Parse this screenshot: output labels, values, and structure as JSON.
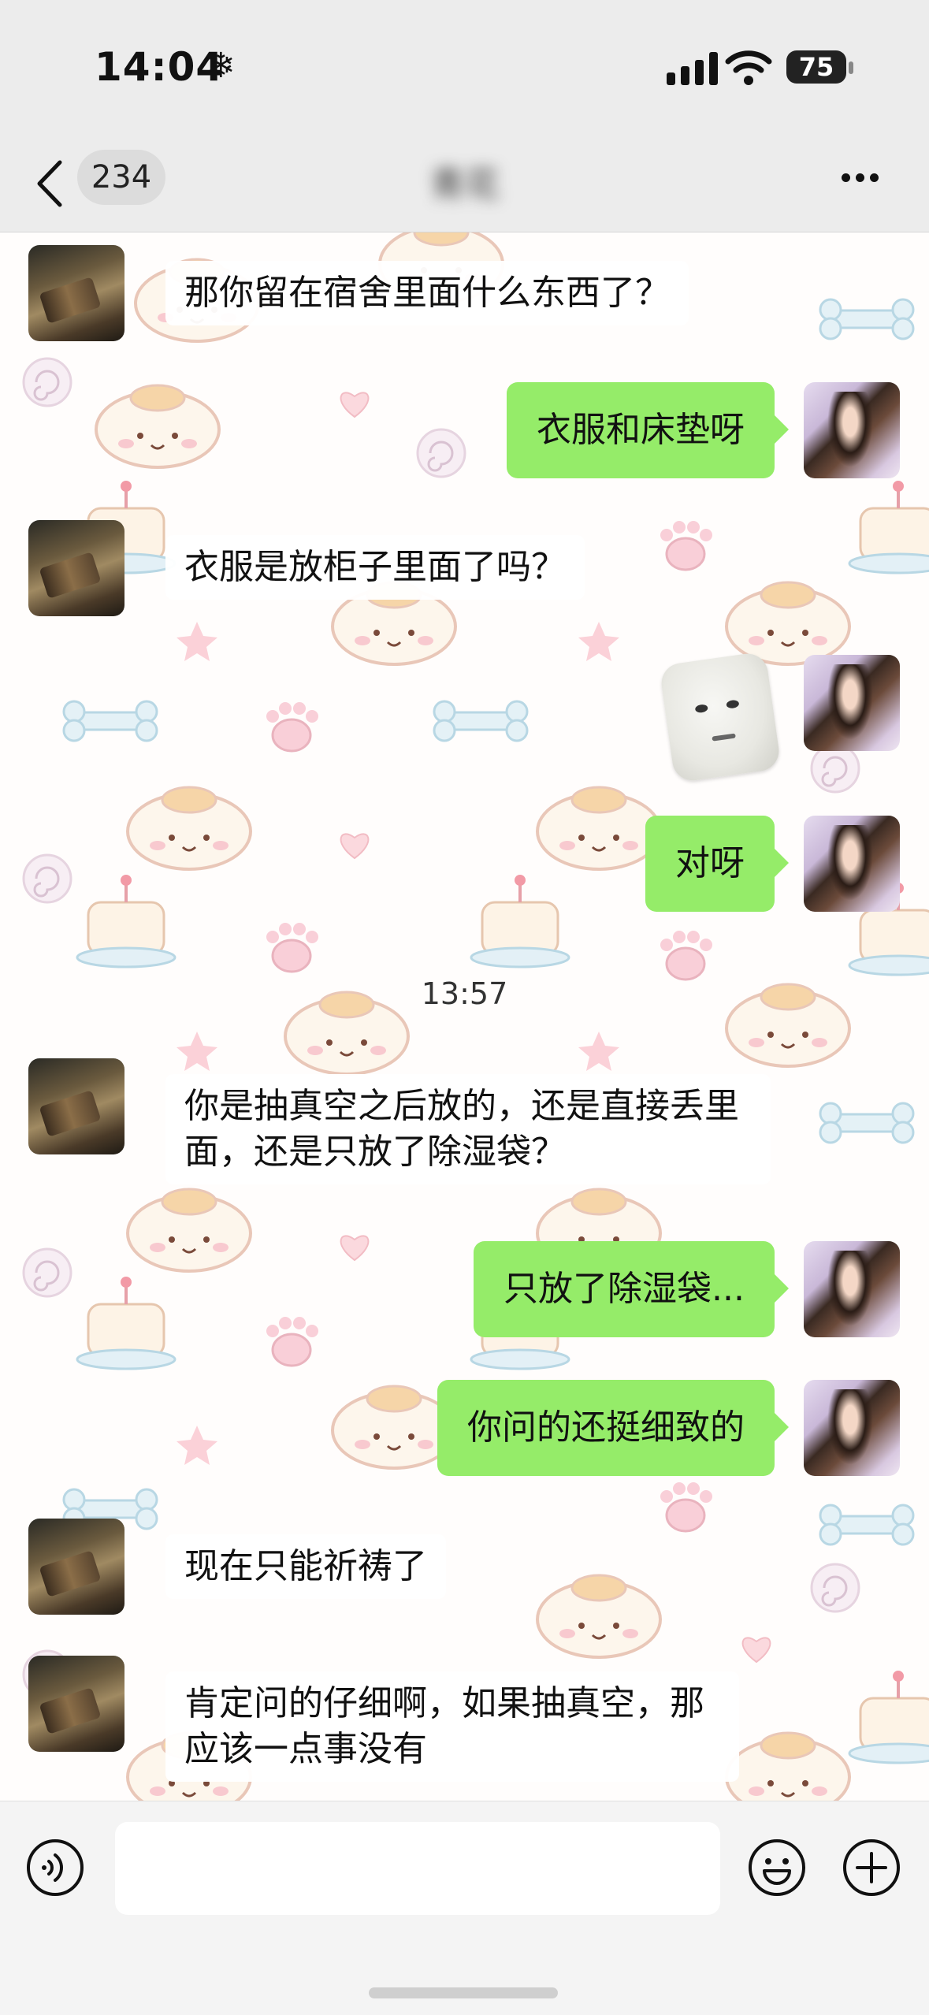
{
  "status_bar": {
    "time": "14:04",
    "weather_glyph": "❄",
    "battery_level": "75"
  },
  "nav_bar": {
    "unread_count": "234",
    "contact_name": "青花",
    "back_icon": "chevron-left-icon",
    "more_icon": "ellipsis-icon"
  },
  "messages": [
    {
      "side": "them",
      "text": "那你留在宿舍里面什么东西了？"
    },
    {
      "side": "me",
      "text": "衣服和床垫呀"
    },
    {
      "side": "them",
      "text": "衣服是放柜子里面了吗？"
    },
    {
      "side": "me",
      "type": "sticker",
      "sticker": "tofu-face-sticker"
    },
    {
      "side": "me",
      "text": "对呀"
    },
    {
      "side": "them",
      "text": "你是抽真空之后放的，还是直接丢里面，还是只放了除湿袋？"
    },
    {
      "side": "me",
      "text": "只放了除湿袋..."
    },
    {
      "side": "me",
      "text": "你问的还挺细致的"
    },
    {
      "side": "them",
      "text": "现在只能祈祷了"
    },
    {
      "side": "them",
      "text": "肯定问的仔细啊，如果抽真空，那应该一点事没有"
    }
  ],
  "timestamp_divider": "13:57",
  "input_bar": {
    "voice_icon": "voice-icon",
    "emoji_icon": "emoji-icon",
    "plus_icon": "plus-icon",
    "text_value": ""
  },
  "colors": {
    "my_bubble": "#95ec69",
    "bars": "#ececec",
    "chat_background": "#fffdfc"
  }
}
